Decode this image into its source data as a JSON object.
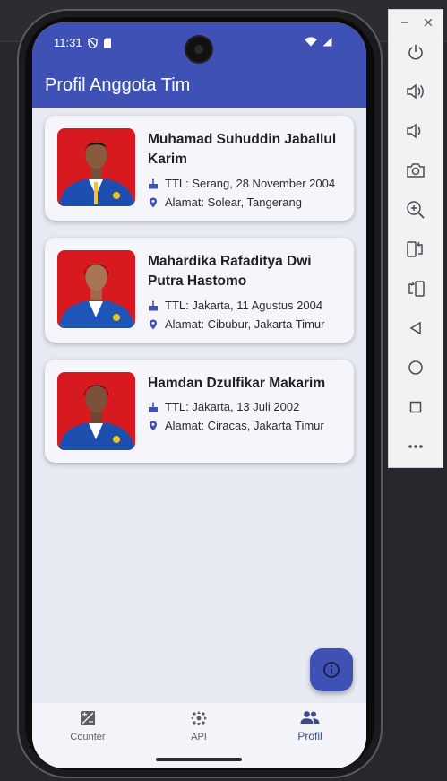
{
  "status_bar": {
    "time": "11:31"
  },
  "app": {
    "title": "Profil Anggota Tim"
  },
  "members": [
    {
      "name": "Muhamad Suhuddin Jaballul Karim",
      "ttl": "TTL: Serang, 28 November 2004",
      "alamat": "Alamat: Solear, Tangerang"
    },
    {
      "name": "Mahardika Rafaditya Dwi Putra Hastomo",
      "ttl": "TTL: Jakarta, 11 Agustus 2004",
      "alamat": "Alamat: Cibubur, Jakarta Timur"
    },
    {
      "name": "Hamdan Dzulfikar Makarim",
      "ttl": "TTL: Jakarta, 13 Juli 2002",
      "alamat": "Alamat: Ciracas, Jakarta Timur"
    }
  ],
  "fab": {
    "icon": "info-icon"
  },
  "nav": {
    "items": [
      {
        "label": "Counter",
        "icon": "counter-icon"
      },
      {
        "label": "API",
        "icon": "api-icon"
      },
      {
        "label": "Profil",
        "icon": "people-icon"
      }
    ],
    "active": "Profil"
  },
  "emulator_toolbar": {
    "buttons": [
      "power-icon",
      "volume-up-icon",
      "volume-down-icon",
      "camera-icon",
      "zoom-icon",
      "rotate-left-icon",
      "rotate-right-icon",
      "back-icon",
      "home-icon",
      "overview-icon",
      "more-icon"
    ]
  },
  "colors": {
    "primary": "#3f51b5",
    "background": "#e8eaf3",
    "card": "#f5f5fb",
    "photo_bg": "#d61a1f"
  }
}
